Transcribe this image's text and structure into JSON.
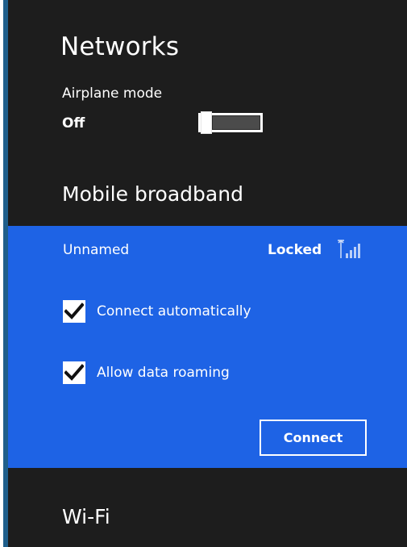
{
  "networks": {
    "title": "Networks",
    "airplane_mode": {
      "label": "Airplane mode",
      "state": "Off"
    },
    "mobile_broadband": {
      "title": "Mobile broadband",
      "network_name": "Unnamed",
      "status": "Locked",
      "options": [
        {
          "label": "Connect automatically",
          "checked": true
        },
        {
          "label": "Allow data roaming",
          "checked": true
        }
      ],
      "connect_label": "Connect"
    },
    "wifi": {
      "title": "Wi-Fi"
    }
  },
  "colors": {
    "dark_background": "#1d1d1d",
    "accent_blue": "#1e63e5",
    "edge_strip": "#1f5f8b",
    "text": "#ffffff"
  },
  "icons": {
    "signal": "cellular-signal-icon",
    "checkmark": "checkmark-icon"
  }
}
